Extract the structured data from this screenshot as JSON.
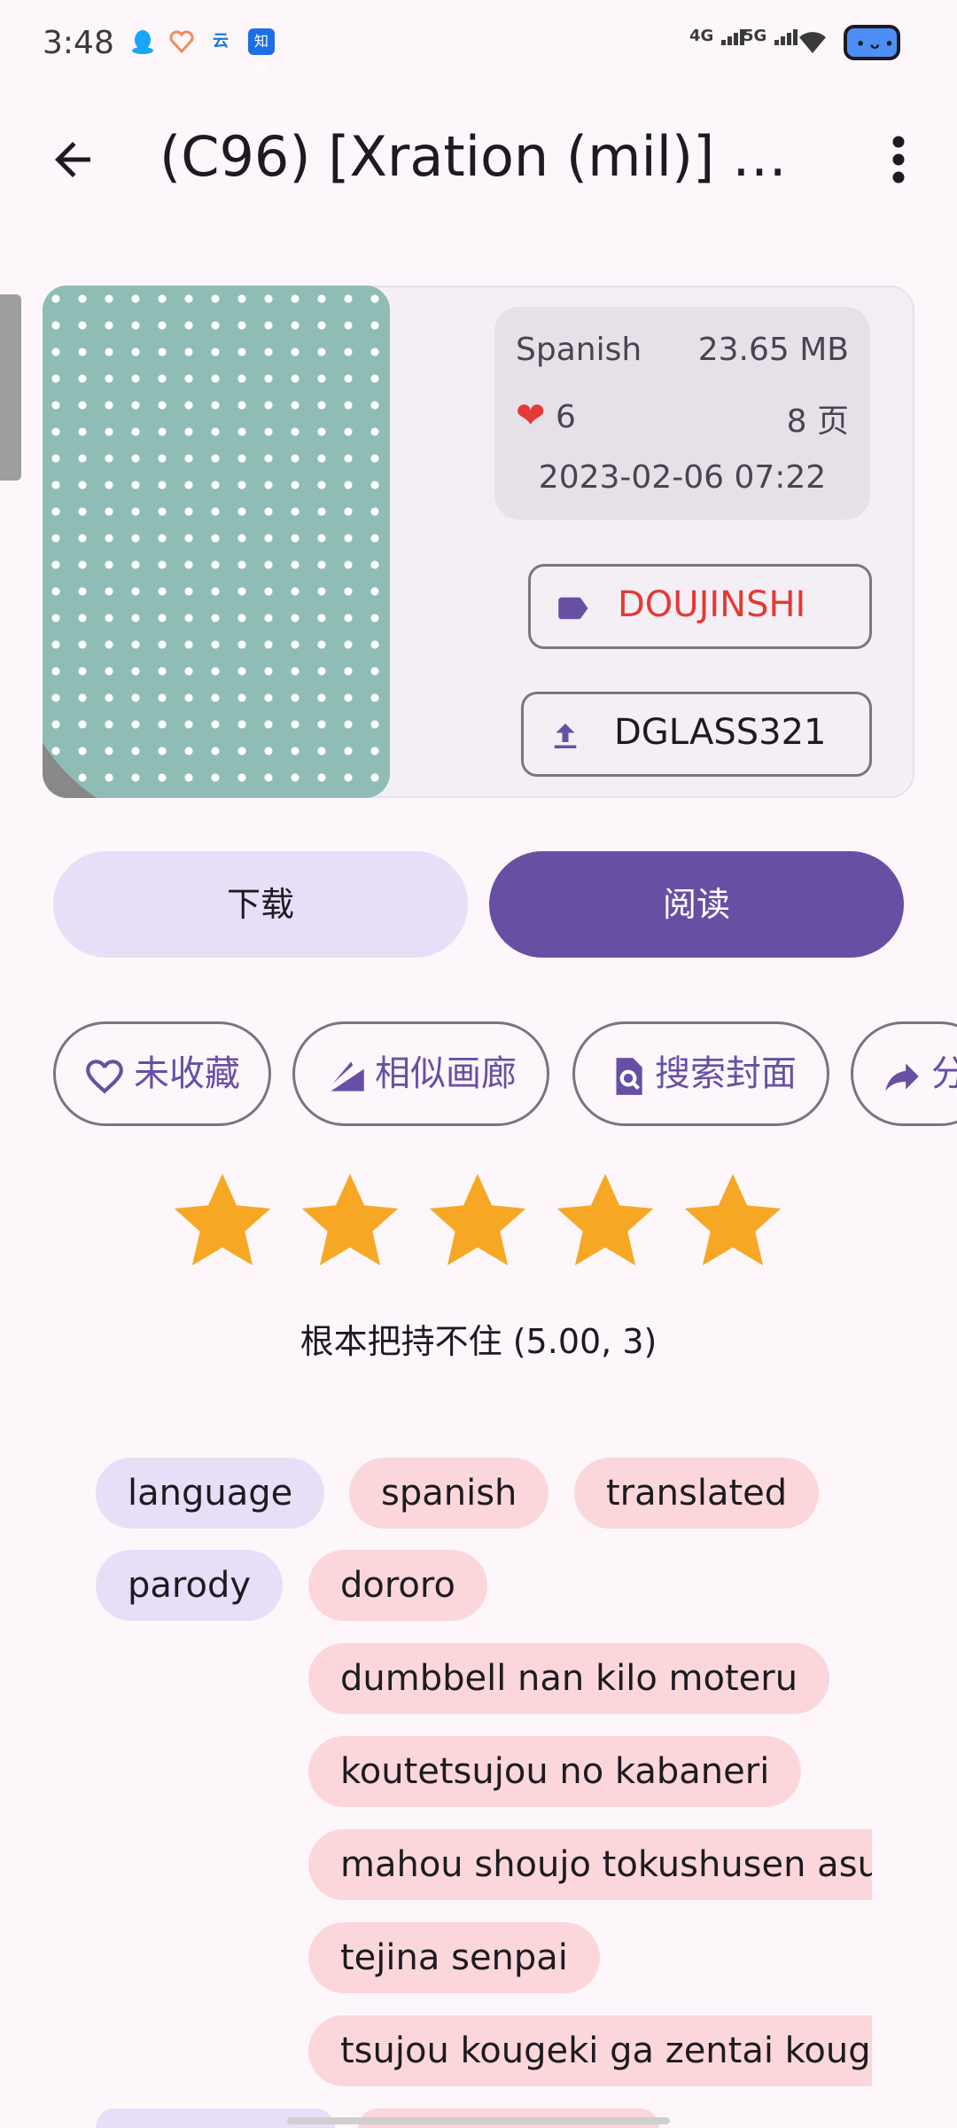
{
  "status_bar": {
    "time": "3:48",
    "network_1": "4G",
    "network_2": "5G",
    "notification_icons": [
      "qq-icon",
      "health-icon",
      "cloud-icon",
      "zhihu-icon"
    ],
    "zhihu_label": "知乎",
    "cloud_label": "云"
  },
  "app_bar": {
    "title": "(C96) [Xration (mil)] b…"
  },
  "gallery": {
    "language": "Spanish",
    "size": "23.65 MB",
    "favorites_count": "6",
    "pages": "8 页",
    "date": "2023-02-06 07:22",
    "category": "DOUJINSHI",
    "category_color": "#e53935",
    "uploader": "DGLASS321"
  },
  "actions": {
    "download": "下载",
    "read": "阅读"
  },
  "chips": {
    "favorite": "未收藏",
    "similar": "相似画廊",
    "search_cover": "搜索封面",
    "share": "分"
  },
  "rating": {
    "stars": 5,
    "text": "根本把持不住 (5.00, 3)"
  },
  "tags": {
    "language_ns": "language",
    "language_values": [
      "spanish",
      "translated"
    ],
    "parody_ns": "parody",
    "parody_values": [
      "dororo",
      "dumbbell nan kilo moteru",
      "koutetsujou no kabaneri",
      "mahou shoujo tokushusen asuka",
      "tejina senpai",
      "tsujou kougeki ga zentai kougeki de ni-kai kougeki no okaasan wa suki desu ka"
    ]
  },
  "colors": {
    "primary": "#6750a4",
    "secondary_container": "#e8def8",
    "tag_value": "#fbd7db",
    "star": "#f6a824"
  }
}
